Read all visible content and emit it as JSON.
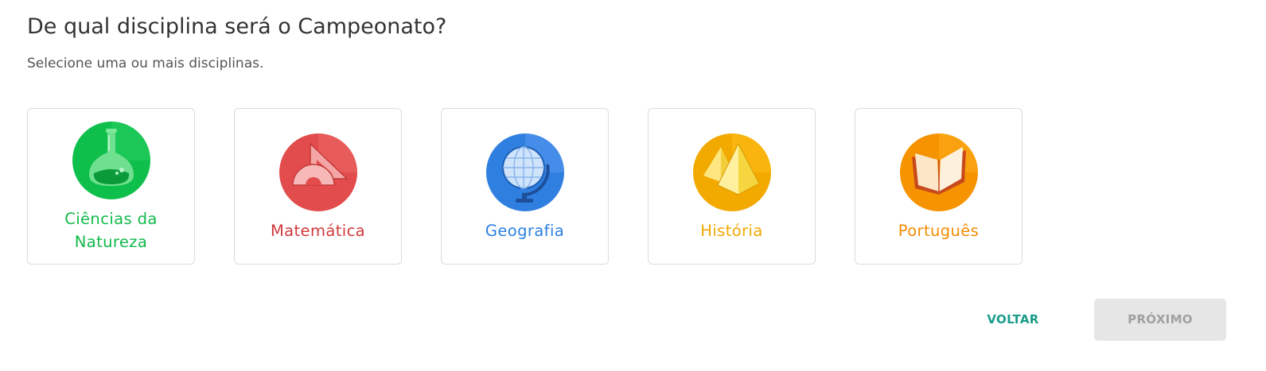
{
  "header": {
    "title": "De qual disciplina será o Campeonato?",
    "subtitle": "Selecione uma ou mais disciplinas."
  },
  "subjects": [
    {
      "label": "Ciências da Natureza",
      "icon": "flask-icon",
      "color": "#12b94a"
    },
    {
      "label": "Matemática",
      "icon": "set-square-protractor-icon",
      "color": "#d2393b"
    },
    {
      "label": "Geografia",
      "icon": "globe-icon",
      "color": "#2b80e0"
    },
    {
      "label": "História",
      "icon": "pyramids-icon",
      "color": "#f0a700"
    },
    {
      "label": "Português",
      "icon": "open-book-icon",
      "color": "#f28b00"
    }
  ],
  "footer": {
    "back_label": "VOLTAR",
    "next_label": "PRÓXIMO",
    "back_color": "#1a9c8a",
    "next_disabled_bg": "#e6e6e6"
  }
}
